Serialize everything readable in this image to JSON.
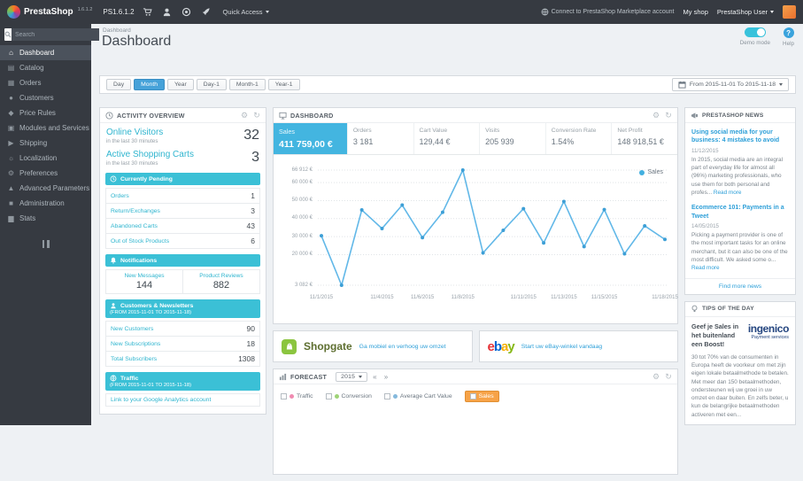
{
  "topbar": {
    "logo_text": "PrestaShop",
    "version": "1.6.1.2",
    "shop_name": "PS1.6.1.2",
    "quick_access": "Quick Access",
    "marketplace_link": "Connect to PrestaShop Marketplace account",
    "my_shop": "My shop",
    "user_name": "PrestaShop User"
  },
  "sidebar": {
    "search_placeholder": "Search",
    "items": [
      {
        "label": "Dashboard"
      },
      {
        "label": "Catalog"
      },
      {
        "label": "Orders"
      },
      {
        "label": "Customers"
      },
      {
        "label": "Price Rules"
      },
      {
        "label": "Modules and Services"
      },
      {
        "label": "Shipping"
      },
      {
        "label": "Localization"
      },
      {
        "label": "Preferences"
      },
      {
        "label": "Advanced Parameters"
      },
      {
        "label": "Administration"
      },
      {
        "label": "Stats"
      }
    ]
  },
  "header": {
    "breadcrumb": "Dashboard",
    "title": "Dashboard",
    "demo_mode": "Demo mode",
    "help": "Help"
  },
  "toolbar": {
    "buttons": [
      "Day",
      "Month",
      "Year",
      "Day-1",
      "Month-1",
      "Year-1"
    ],
    "active_button": "Month",
    "date_range": "From 2015-11-01 To 2015-11-18"
  },
  "activity": {
    "title": "Activity overview",
    "online_visitors_label": "Online Visitors",
    "online_visitors_value": "32",
    "online_visitors_sub": "in the last 30 minutes",
    "active_carts_label": "Active Shopping Carts",
    "active_carts_value": "3",
    "active_carts_sub": "in the last 30 minutes",
    "pending_title": "Currently Pending",
    "pending_rows": [
      {
        "label": "Orders",
        "value": "1"
      },
      {
        "label": "Return/Exchanges",
        "value": "3"
      },
      {
        "label": "Abandoned Carts",
        "value": "43"
      },
      {
        "label": "Out of Stock Products",
        "value": "6"
      }
    ],
    "notifications_title": "Notifications",
    "notifications": [
      {
        "label": "New Messages",
        "value": "144"
      },
      {
        "label": "Product Reviews",
        "value": "882"
      }
    ],
    "customers_title": "Customers & Newsletters",
    "customers_subtitle": "(FROM 2015-11-01 TO 2015-11-18)",
    "customers_rows": [
      {
        "label": "New Customers",
        "value": "90"
      },
      {
        "label": "New Subscriptions",
        "value": "18"
      },
      {
        "label": "Total Subscribers",
        "value": "1308"
      }
    ],
    "traffic_title": "Traffic",
    "traffic_subtitle": "(FROM 2015-11-01 TO 2015-11-18)",
    "traffic_link": "Link to your Google Analytics account"
  },
  "dashboard_panel": {
    "title": "Dashboard",
    "kpis": [
      {
        "label": "Sales",
        "value": "411 759,00 €"
      },
      {
        "label": "Orders",
        "value": "3 181"
      },
      {
        "label": "Cart Value",
        "value": "129,44 €"
      },
      {
        "label": "Visits",
        "value": "205 939"
      },
      {
        "label": "Conversion Rate",
        "value": "1.54%"
      },
      {
        "label": "Net Profit",
        "value": "148 918,51 €"
      }
    ],
    "legend": "Sales"
  },
  "chart_data": {
    "type": "line",
    "title": "Sales",
    "x": [
      "11/1/2015",
      "11/2/2015",
      "11/3/2015",
      "11/4/2015",
      "11/5/2015",
      "11/6/2015",
      "11/7/2015",
      "11/8/2015",
      "11/9/2015",
      "11/10/2015",
      "11/11/2015",
      "11/12/2015",
      "11/13/2015",
      "11/14/2015",
      "11/15/2015",
      "11/16/2015",
      "11/17/2015",
      "11/18/2015"
    ],
    "values": [
      30500,
      3082,
      44800,
      34500,
      47500,
      29500,
      43500,
      66912,
      21000,
      33500,
      45500,
      26500,
      49500,
      24500,
      45000,
      20500,
      36000,
      28500
    ],
    "ylim": [
      3082,
      66912
    ],
    "y_ticks": [
      {
        "value": 66912,
        "label": "66 912 €"
      },
      {
        "value": 60000,
        "label": "60 000 €"
      },
      {
        "value": 50000,
        "label": "50 000 €"
      },
      {
        "value": 40000,
        "label": "40 000 €"
      },
      {
        "value": 30000,
        "label": "30 000 €"
      },
      {
        "value": 20000,
        "label": "20 000 €"
      },
      {
        "value": 3082,
        "label": "3 082 €"
      }
    ],
    "x_ticks": [
      {
        "i": 0,
        "label": "11/1/2015"
      },
      {
        "i": 3,
        "label": "11/4/2015"
      },
      {
        "i": 5,
        "label": "11/6/2015"
      },
      {
        "i": 7,
        "label": "11/8/2015"
      },
      {
        "i": 10,
        "label": "11/11/2015"
      },
      {
        "i": 12,
        "label": "11/13/2015"
      },
      {
        "i": 14,
        "label": "11/15/2015"
      },
      {
        "i": 17,
        "label": "11/18/2015"
      }
    ],
    "grid": true,
    "legend_position": "top-right",
    "line_color": "#62b8e8",
    "point_color": "#3d9fd6"
  },
  "promos": {
    "shopgate_name": "Shopgate",
    "shopgate_link": "Ga mobiel en verhoog uw omzet",
    "ebay_letters": [
      "e",
      "b",
      "a",
      "y"
    ],
    "ebay_link": "Start uw eBay-winkel vandaag"
  },
  "forecast": {
    "title": "Forecast",
    "year": "2015",
    "prev": "«",
    "next": "»",
    "legend": [
      {
        "label": "Traffic"
      },
      {
        "label": "Conversion"
      },
      {
        "label": "Average Cart Value"
      },
      {
        "label": "Sales",
        "active": true
      }
    ]
  },
  "news": {
    "title": "PrestaShop News",
    "articles": [
      {
        "title": "Using social media for your business: 4 mistakes to avoid",
        "date": "11/12/2015",
        "excerpt": "In 2015, social media are an integral part of everyday life for almost all (96%) marketing professionals, who use them for both personal and profes...",
        "read_more": "Read more"
      },
      {
        "title": "Ecommerce 101: Payments in a Tweet",
        "date": "14/05/2015",
        "excerpt": "Picking a payment provider is one of the most important tasks for an online merchant, but it can also be one of the most difficult. We asked some o...",
        "read_more": "Read more"
      }
    ],
    "more_link": "Find more news"
  },
  "tips": {
    "title": "Tips of the day",
    "headline": "Geef je Sales in het buitenland een Boost!",
    "brand": "ingenico",
    "brand_sub": "Payment services",
    "body": "30 tot 70% van de consumenten in Europa heeft de voorkeur om met zijn eigen lokale betaalmethode te betalen. Met meer dan 150 betaalmethoden, ondersteunen wij uw groei in uw omzet en daar buiten. En zelfs beter, u kun de belangrijke betaalmethoden activeren met een..."
  },
  "colors": {
    "topbar_bg": "#363a41",
    "accent_cyan": "#3bc0d6",
    "link_blue": "#2d9fd8",
    "active_button_blue": "#46a2d9",
    "kpi_active_blue": "#43b5e0",
    "sales_orange": "#f7a348",
    "shopgate_green": "#8bc53f",
    "ebay_colors": [
      "#e53238",
      "#0064d2",
      "#f5af02",
      "#86b817"
    ],
    "ingenico_blue": "#24457f"
  }
}
